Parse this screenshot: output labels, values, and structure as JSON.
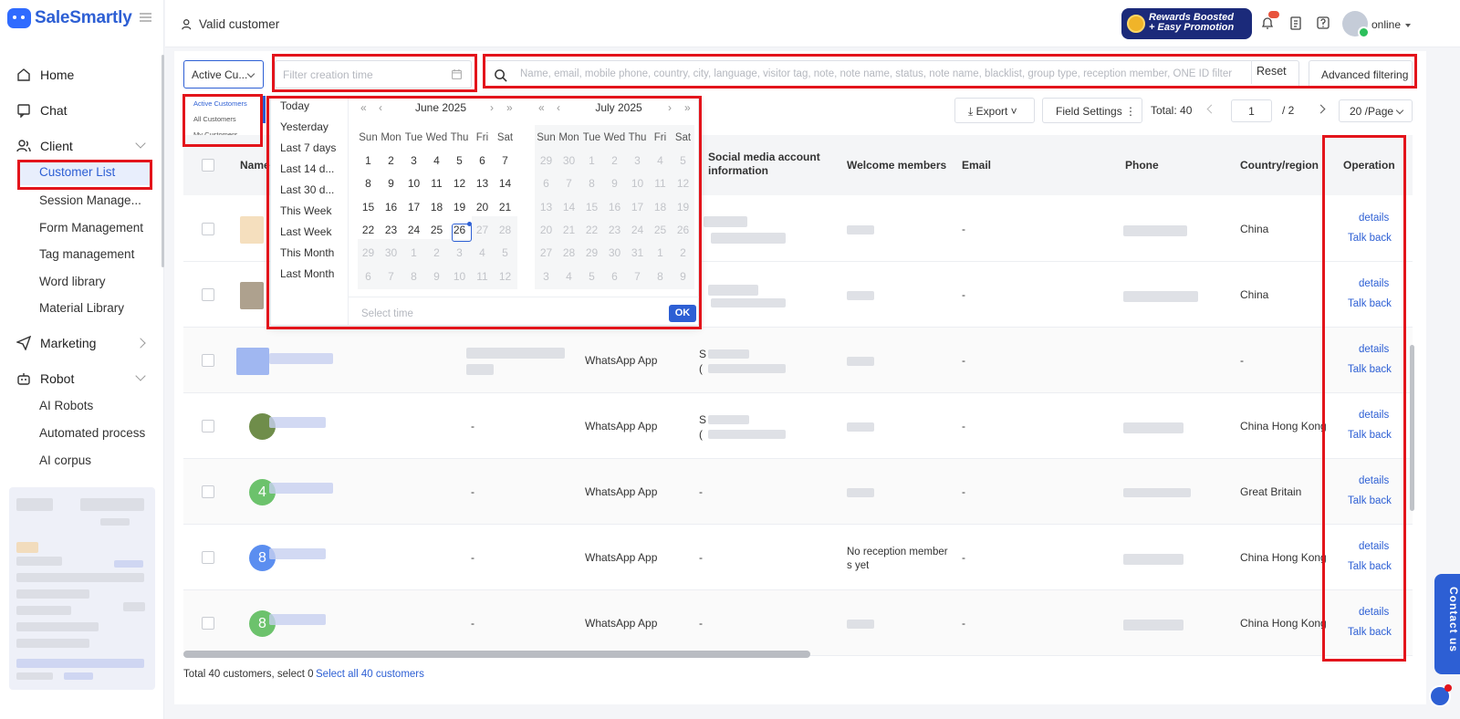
{
  "brand": {
    "name": "SaleSmartly"
  },
  "header": {
    "title": "Valid customer",
    "promo_line1": "Rewards Boosted",
    "promo_line2": "+ Easy Promotion",
    "status": "online"
  },
  "sidebar": {
    "home": "Home",
    "chat": "Chat",
    "client": "Client",
    "client_items": [
      "Customer List",
      "Session Manage...",
      "Form Management",
      "Tag management",
      "Word library",
      "Material Library"
    ],
    "marketing": "Marketing",
    "robot": "Robot",
    "robot_items": [
      "AI Robots",
      "Automated process",
      "AI corpus"
    ]
  },
  "filters": {
    "customer_scope": "Active Cu...",
    "scope_options": [
      "Active Customers",
      "All Customers",
      "My Customers"
    ],
    "date_placeholder": "Filter creation time",
    "search_placeholder": "Name, email, mobile phone, country, city, language, visitor tag, note, note name, status, note name, blacklist, group type, reception member, ONE ID filter",
    "reset": "Reset",
    "advanced": "Advanced filtering"
  },
  "toolbar": {
    "export": "Export",
    "field_settings": "Field Settings",
    "total_label": "Total:  40",
    "page": "1",
    "page_total": "/  2",
    "per_page": "20 /Page"
  },
  "table": {
    "headers": {
      "name": "Name",
      "social": "Social media account information",
      "welcome": "Welcome members",
      "email": "Email",
      "phone": "Phone",
      "country": "Country/region",
      "operation": "Operation"
    },
    "rows": [
      {
        "avatar": "",
        "col3": "",
        "channel": "",
        "social": "",
        "welcome": "",
        "email": "-",
        "country": "China"
      },
      {
        "avatar": "",
        "col3": "",
        "channel": "",
        "social": "",
        "welcome": "",
        "email": "-",
        "country": "China"
      },
      {
        "avatar": "",
        "col3": "",
        "channel": "WhatsApp App",
        "social": "S",
        "social2": "(",
        "welcome": "",
        "email": "-",
        "country": "-"
      },
      {
        "avatar": "",
        "col3": "-",
        "channel": "WhatsApp App",
        "social": "S",
        "social2": "(",
        "welcome": "",
        "email": "-",
        "country": "China Hong Kong"
      },
      {
        "avatar": "4",
        "col3": "-",
        "channel": "WhatsApp App",
        "social": "-",
        "welcome": "",
        "email": "-",
        "country": "Great Britain"
      },
      {
        "avatar": "8",
        "col3": "-",
        "channel": "WhatsApp App",
        "social": "-",
        "welcome": "No reception member s yet",
        "email": "-",
        "country": "China Hong Kong"
      },
      {
        "avatar": "8",
        "col3": "-",
        "channel": "WhatsApp App",
        "social": "-",
        "welcome": "",
        "email": "-",
        "country": "China Hong Kong"
      }
    ],
    "op_details": "details",
    "op_talk_back": "Talk back"
  },
  "footer": {
    "summary": "Total 40 customers, select 0",
    "select_all": "Select all 40 customers"
  },
  "datepicker": {
    "shortcuts": [
      "Today",
      "Yesterday",
      "Last 7 days",
      "Last 14 d...",
      "Last 30 d...",
      "This Week",
      "Last Week",
      "This Month",
      "Last Month"
    ],
    "left_month": "June 2025",
    "right_month": "July 2025",
    "weekdays": [
      "Sun",
      "Mon",
      "Tue",
      "Wed",
      "Thu",
      "Fri",
      "Sat"
    ],
    "left_days": [
      [
        "1",
        "2",
        "3",
        "4",
        "5",
        "6",
        "7"
      ],
      [
        "8",
        "9",
        "10",
        "11",
        "12",
        "13",
        "14"
      ],
      [
        "15",
        "16",
        "17",
        "18",
        "19",
        "20",
        "21"
      ],
      [
        "22",
        "23",
        "24",
        "25",
        "26",
        "27",
        "28"
      ],
      [
        "29",
        "30",
        "1",
        "2",
        "3",
        "4",
        "5"
      ],
      [
        "6",
        "7",
        "8",
        "9",
        "10",
        "11",
        "12"
      ]
    ],
    "right_days": [
      [
        "29",
        "30",
        "1",
        "2",
        "3",
        "4",
        "5"
      ],
      [
        "6",
        "7",
        "8",
        "9",
        "10",
        "11",
        "12"
      ],
      [
        "13",
        "14",
        "15",
        "16",
        "17",
        "18",
        "19"
      ],
      [
        "20",
        "21",
        "22",
        "23",
        "24",
        "25",
        "26"
      ],
      [
        "27",
        "28",
        "29",
        "30",
        "31",
        "1",
        "2"
      ],
      [
        "3",
        "4",
        "5",
        "6",
        "7",
        "8",
        "9"
      ]
    ],
    "select_time": "Select time",
    "ok": "OK"
  },
  "contact": {
    "label": "Contact us"
  },
  "colors": {
    "accent": "#2d5fd4",
    "highlight": "#e3141b",
    "avatar_green": "#6cc26c",
    "avatar_blue": "#5b8ef0"
  }
}
